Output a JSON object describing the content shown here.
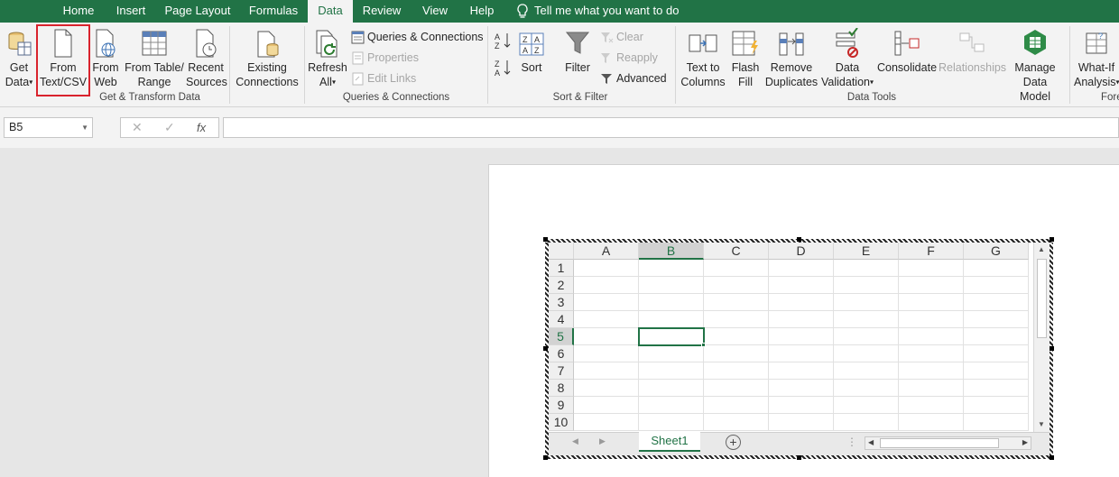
{
  "tabs": [
    {
      "label": "Home",
      "active": false
    },
    {
      "label": "Insert",
      "active": false
    },
    {
      "label": "Page Layout",
      "active": false
    },
    {
      "label": "Formulas",
      "active": false
    },
    {
      "label": "Data",
      "active": true
    },
    {
      "label": "Review",
      "active": false
    },
    {
      "label": "View",
      "active": false
    },
    {
      "label": "Help",
      "active": false
    }
  ],
  "tell_me": "Tell me what you want to do",
  "ribbon": {
    "get_transform": {
      "label": "Get & Transform Data",
      "get_data_1": "Get",
      "get_data_2": "Data",
      "from_text_1": "From",
      "from_text_2": "Text/CSV",
      "from_web_1": "From",
      "from_web_2": "Web",
      "from_table_1": "From Table/",
      "from_table_2": "Range",
      "recent_1": "Recent",
      "recent_2": "Sources",
      "existing_1": "Existing",
      "existing_2": "Connections"
    },
    "queries": {
      "label": "Queries & Connections",
      "refresh_1": "Refresh",
      "refresh_2": "All",
      "queries_connections": "Queries & Connections",
      "properties": "Properties",
      "edit_links": "Edit Links"
    },
    "sort_filter": {
      "label": "Sort & Filter",
      "sort": "Sort",
      "filter": "Filter",
      "clear": "Clear",
      "reapply": "Reapply",
      "advanced": "Advanced"
    },
    "data_tools": {
      "label": "Data Tools",
      "text_to_columns_1": "Text to",
      "text_to_columns_2": "Columns",
      "flash_fill_1": "Flash",
      "flash_fill_2": "Fill",
      "remove_dup_1": "Remove",
      "remove_dup_2": "Duplicates",
      "validation_1": "Data",
      "validation_2": "Validation",
      "consolidate": "Consolidate",
      "relationships": "Relationships",
      "manage_model_1": "Manage",
      "manage_model_2": "Data Model"
    },
    "forecast": {
      "label": "Fore",
      "whatif_1": "What-If",
      "whatif_2": "Analysis"
    }
  },
  "formula_bar": {
    "name_box": "B5",
    "formula": ""
  },
  "sheet": {
    "columns": [
      "A",
      "B",
      "C",
      "D",
      "E",
      "F",
      "G"
    ],
    "rows": [
      "1",
      "2",
      "3",
      "4",
      "5",
      "6",
      "7",
      "8",
      "9",
      "10"
    ],
    "selected_column": "B",
    "selected_row": "5",
    "tab_name": "Sheet1"
  },
  "colors": {
    "accent": "#217346",
    "highlight_box": "#d9232d"
  }
}
